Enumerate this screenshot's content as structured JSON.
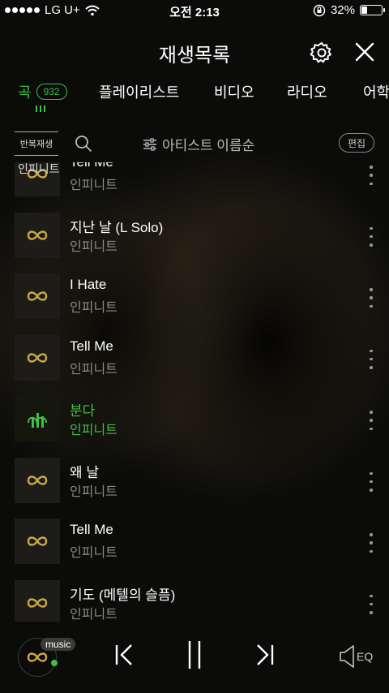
{
  "status": {
    "carrier": "LG U+",
    "time": "오전 2:13",
    "battery": "32%",
    "battery_level": 0.32
  },
  "header": {
    "title": "재생목록"
  },
  "tabs": [
    {
      "label": "곡",
      "count": "932"
    },
    {
      "label": "플레이리스트"
    },
    {
      "label": "비디오"
    },
    {
      "label": "라디오"
    },
    {
      "label": "어학"
    }
  ],
  "toolbar": {
    "repeat_label": "반복재생",
    "sort_label": "아티스트 이름순",
    "edit_label": "편집"
  },
  "songs": [
    {
      "title": "Tell Me",
      "artist": "인피니트",
      "thumb_label": "인피니트"
    },
    {
      "title": "지난 날 (L Solo)",
      "artist": "인피니트"
    },
    {
      "title": "I Hate",
      "artist": "인피니트"
    },
    {
      "title": "Tell Me",
      "artist": "인피니트"
    },
    {
      "title": "분다",
      "artist": "인피니트",
      "playing": true
    },
    {
      "title": "왜 날",
      "artist": "인피니트"
    },
    {
      "title": "Tell Me",
      "artist": "인피니트"
    },
    {
      "title": "기도 (메텔의 슬픔)",
      "artist": "인피니트"
    }
  ],
  "player": {
    "badge": "music",
    "eq_label": "EQ"
  },
  "colors": {
    "accent": "#3fbf46",
    "logo_gold": "#c9a84a"
  }
}
